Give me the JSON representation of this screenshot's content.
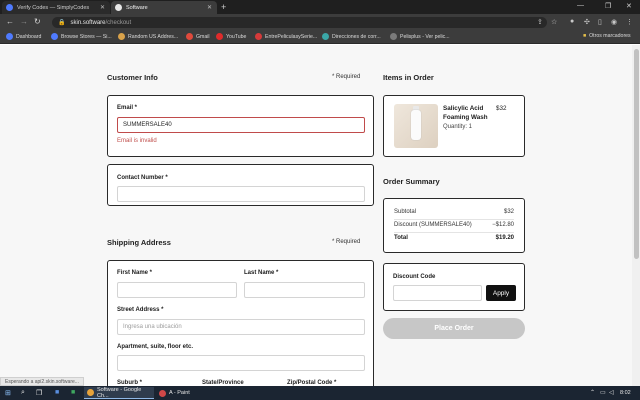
{
  "browser": {
    "tabs": [
      {
        "title": "Verify Codes — SimplyCodes",
        "close": "✕"
      },
      {
        "title": "Software",
        "close": "✕"
      }
    ],
    "new_tab": "+",
    "window_controls": {
      "minimize": "—",
      "maximize": "❐",
      "close": "✕"
    },
    "nav": {
      "back": "←",
      "forward": "→",
      "reload": "↻"
    },
    "address": {
      "host": "skin.software",
      "path": "/checkout"
    },
    "bookmarks": [
      {
        "label": "Dashboard",
        "color": "#4f7bff"
      },
      {
        "label": "Browse Stores — Si...",
        "color": "#4f7bff"
      },
      {
        "label": "Random US Addres...",
        "color": "#d9a24a"
      },
      {
        "label": "Gmail",
        "color": "#e04a3c"
      },
      {
        "label": "YouTube",
        "color": "#e02b2b"
      },
      {
        "label": "EntrePeliculasySerie...",
        "color": "#d63a3a"
      },
      {
        "label": "Direcciones de corr...",
        "color": "#3aa6a6"
      },
      {
        "label": "Pelisplus - Ver pelic...",
        "color": "#7a7a7a"
      }
    ],
    "other_bookmarks": "Otros marcadores",
    "status_link": "Esperando a api2.skin.software..."
  },
  "checkout": {
    "customer_info": {
      "title": "Customer Info",
      "required": "* Required",
      "email_label": "Email *",
      "email_value": "SUMMERSALE40",
      "email_error": "Email is invalid",
      "contact_label": "Contact Number *",
      "contact_value": ""
    },
    "shipping": {
      "title": "Shipping Address",
      "required": "* Required",
      "first_name_label": "First Name *",
      "last_name_label": "Last Name *",
      "street_label": "Street Address *",
      "street_placeholder": "Ingresa una ubicación",
      "apartment_label": "Apartment, suite, floor etc.",
      "suburb_label": "Suburb *",
      "state_label": "State/Province",
      "zip_label": "Zip/Postal Code *"
    },
    "items": {
      "title": "Items in Order",
      "list": [
        {
          "name_line1": "Salicylic Acid",
          "name_line2": "Foaming Wash",
          "price": "$32",
          "quantity": "Quantity: 1"
        }
      ]
    },
    "summary": {
      "title": "Order Summary",
      "rows": [
        {
          "label": "Subtotal",
          "value": "$32"
        },
        {
          "label": "Discount (SUMMERSALE40)",
          "value": "−$12.80"
        },
        {
          "label": "Total",
          "value": "$19.20"
        }
      ]
    },
    "discount": {
      "label": "Discount Code",
      "value": "",
      "apply_label": "Apply"
    },
    "place_order_label": "Place Order"
  },
  "taskbar": {
    "apps": [
      {
        "label": "Software - Google Ch...",
        "color": "#e8a33a"
      },
      {
        "label": "A - Paint",
        "color": "#d04848"
      }
    ],
    "time": "8:02"
  }
}
